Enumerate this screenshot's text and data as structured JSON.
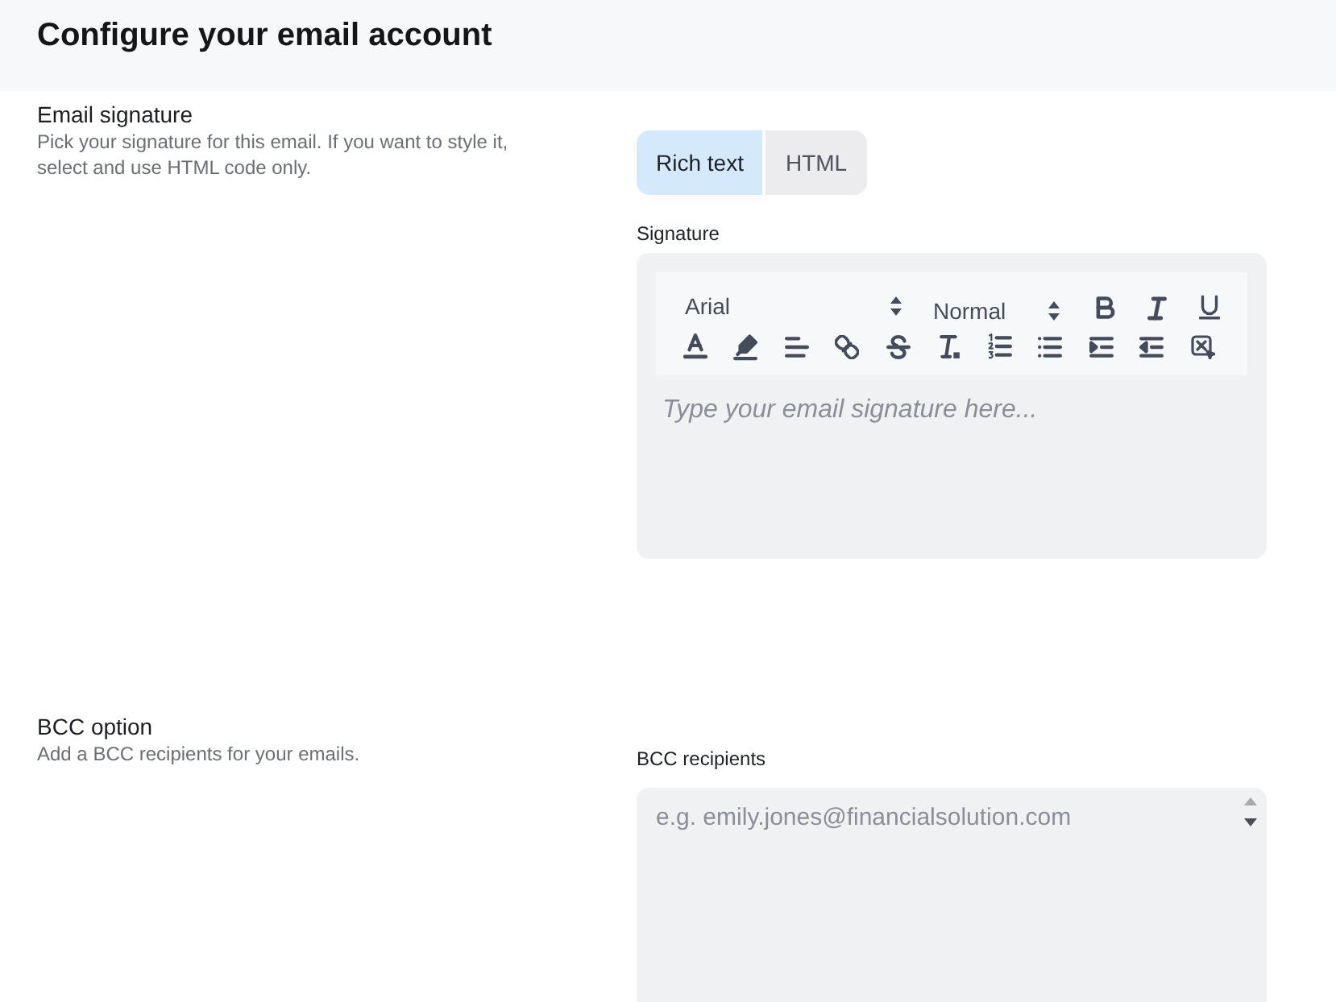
{
  "header": {
    "title": "Configure your email account"
  },
  "sections": [
    {
      "kind": "signature",
      "title": "Email signature",
      "description": "Pick your signature for this email. If you want to style it, select and use HTML code only.",
      "mode_tabs": [
        {
          "label": "Rich text",
          "selected": true
        },
        {
          "label": "HTML",
          "selected": false
        }
      ],
      "field_label": "Signature",
      "editor": {
        "font": "Arial",
        "size": "Normal",
        "placeholder": "Type your email signature here..."
      }
    },
    {
      "kind": "bcc",
      "title": "BCC option",
      "description": "Add a BCC recipients for your emails.",
      "field_label": "BCC recipients",
      "placeholder": "e.g. emily.jones@financialsolution.com"
    }
  ]
}
